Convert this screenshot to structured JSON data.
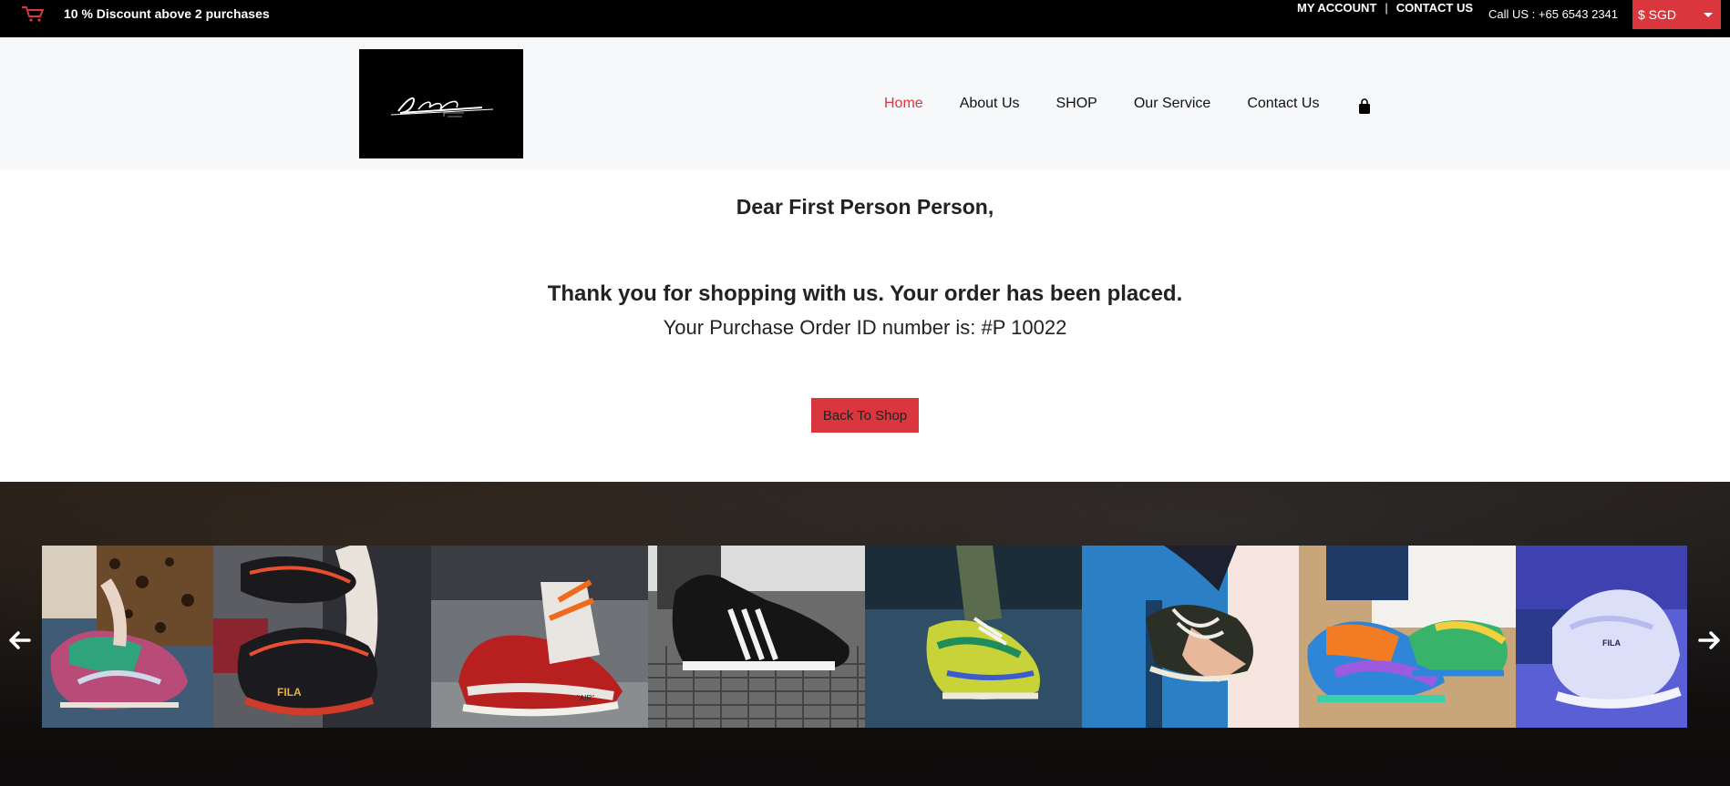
{
  "topbar": {
    "promo": "10 % Discount above 2 purchases",
    "my_account": "MY ACCOUNT",
    "separator": "|",
    "contact_us": "CONTACT US",
    "call": "Call US : +65 6543 2341",
    "currency": "$ SGD"
  },
  "header": {
    "logo_icon": "limited-edition-logo",
    "nav": [
      {
        "label": "Home",
        "active": true
      },
      {
        "label": "About Us",
        "active": false
      },
      {
        "label": "SHOP",
        "active": false
      },
      {
        "label": "Our Service",
        "active": false
      },
      {
        "label": "Contact Us",
        "active": false
      }
    ],
    "cart_icon": "shopping-bag-icon"
  },
  "main": {
    "greeting": "Dear First Person Person,",
    "thanks": "Thank you for shopping with us. Your order has been placed.",
    "order_id": "Your Purchase Order ID number is: #P 10022",
    "back_button": "Back To Shop"
  },
  "gallery": {
    "prev_icon": "arrow-left-icon",
    "next_icon": "arrow-right-icon",
    "items": [
      "sneaker-photo-1",
      "sneaker-photo-2",
      "sneaker-photo-3",
      "sneaker-photo-4",
      "sneaker-photo-5",
      "sneaker-photo-6",
      "sneaker-photo-7",
      "sneaker-photo-8"
    ]
  },
  "colors": {
    "accent": "#d9363e",
    "topbar_bg": "#000000",
    "header_bg": "#f7f8fa"
  }
}
